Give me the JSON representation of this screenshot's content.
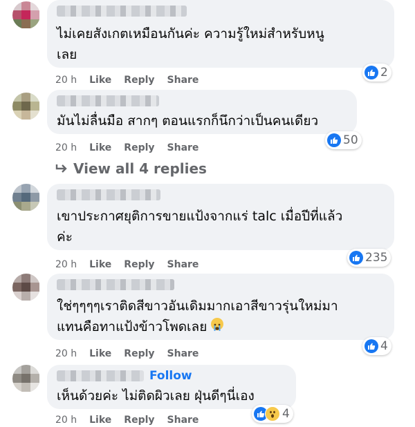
{
  "comments": [
    {
      "text": "ไม่เคยสังเกตเหมือนกันค่ะ ความรู้ใหม่สำหรับหนู\nเลย",
      "time": "20 h",
      "like": "Like",
      "reply": "Reply",
      "share": "Share",
      "reactions": "2"
    },
    {
      "text": "มันไม่ลื่นมือ สากๆ ตอนแรกก็นึกว่าเป็นคนเดียว",
      "time": "20 h",
      "like": "Like",
      "reply": "Reply",
      "share": "Share",
      "reactions": "50"
    },
    {
      "text": "เขาประกาศยุติการขายแป้งจากแร่ talc เมื่อปีที่แล้ว\nค่ะ",
      "time": "20 h",
      "like": "Like",
      "reply": "Reply",
      "share": "Share",
      "reactions": "235"
    },
    {
      "text": "ใช่ๆๆๆๆเราติดสีขาวอันเดิมมากเอาสีขาวรุ่นใหม่มา\nแทนคือทาแป้งข้าวโพดเลย",
      "time": "20 h",
      "like": "Like",
      "reply": "Reply",
      "share": "Share",
      "reactions": "4"
    },
    {
      "text": "เห็นด้วยค่ะ ไม่ติดผิวเลย ฝุ่นดีๆนี่เอง",
      "time": "20 h",
      "like": "Like",
      "reply": "Reply",
      "share": "Share",
      "reactions": "4",
      "follow": "Follow"
    }
  ],
  "view_replies": "View all 4 replies",
  "colors": {
    "bubble": "#f0f2f5",
    "meta": "#65676b",
    "link": "#1877f2",
    "like": "#1877f2"
  }
}
